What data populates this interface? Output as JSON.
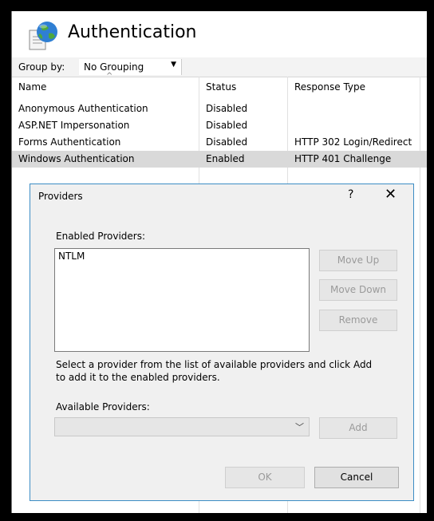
{
  "header": {
    "title": "Authentication",
    "icon": "globe-document-icon"
  },
  "group_by": {
    "label": "Group by:",
    "value": "No Grouping"
  },
  "table": {
    "columns": [
      "Name",
      "Status",
      "Response Type"
    ],
    "rows": [
      {
        "name": "Anonymous Authentication",
        "status": "Disabled",
        "response": ""
      },
      {
        "name": "ASP.NET Impersonation",
        "status": "Disabled",
        "response": ""
      },
      {
        "name": "Forms Authentication",
        "status": "Disabled",
        "response": "HTTP 302 Login/Redirect"
      },
      {
        "name": "Windows Authentication",
        "status": "Enabled",
        "response": "HTTP 401 Challenge",
        "selected": true
      }
    ]
  },
  "dialog": {
    "title": "Providers",
    "help": "?",
    "close": "✕",
    "enabled_label": "Enabled Providers:",
    "enabled_items": [
      "NTLM"
    ],
    "move_up": "Move Up",
    "move_down": "Move Down",
    "remove": "Remove",
    "hint": "Select a provider from the list of available providers and click Add to add it to the enabled providers.",
    "available_label": "Available Providers:",
    "available_value": "",
    "add": "Add",
    "ok": "OK",
    "cancel": "Cancel"
  },
  "colors": {
    "selected_row": "#d9d9d9",
    "dialog_border": "#3c8dc5",
    "dialog_bg": "#f0f0f0"
  }
}
